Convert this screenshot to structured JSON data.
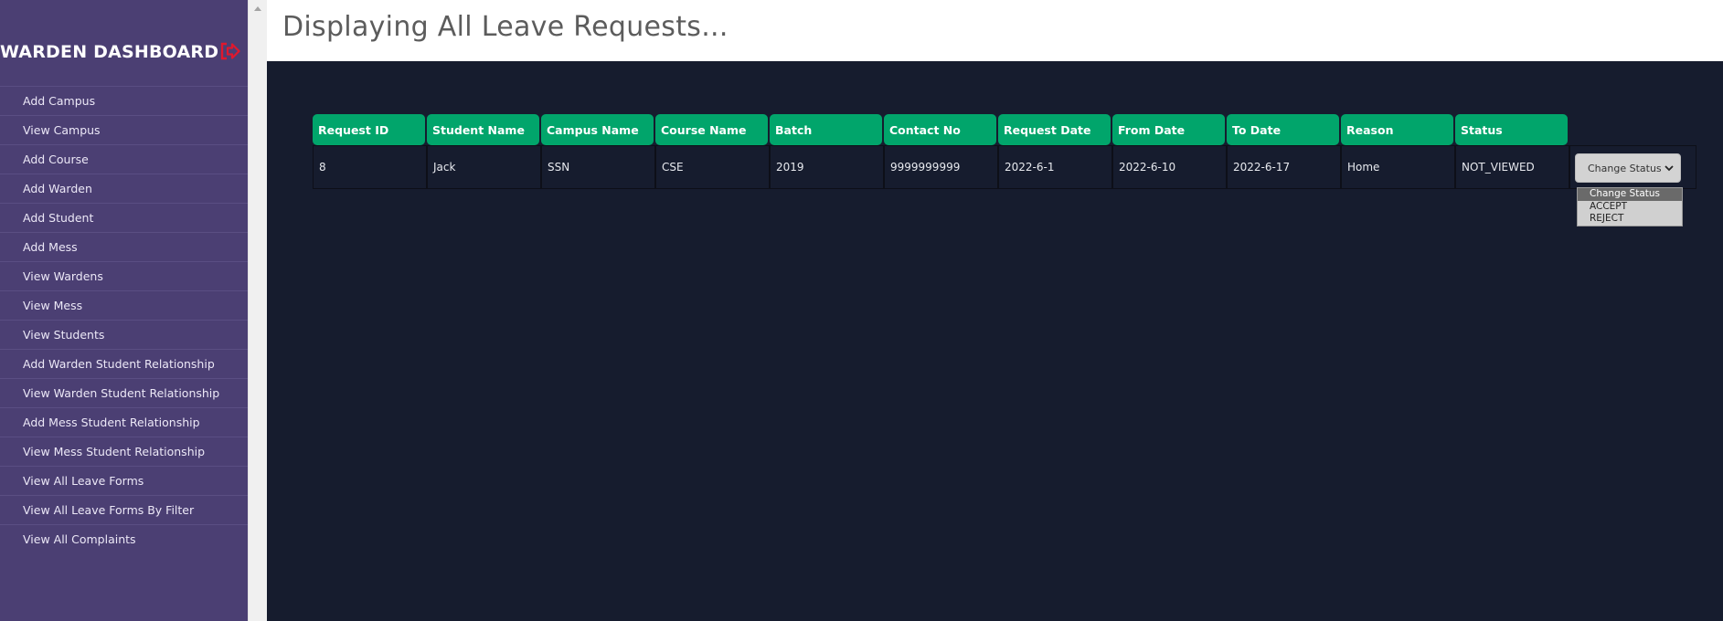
{
  "sidebar": {
    "title": "WARDEN DASHBOARD",
    "items": [
      {
        "label": "Add Campus"
      },
      {
        "label": "View Campus"
      },
      {
        "label": "Add Course"
      },
      {
        "label": "Add Warden"
      },
      {
        "label": "Add Student"
      },
      {
        "label": "Add Mess"
      },
      {
        "label": "View Wardens"
      },
      {
        "label": "View Mess"
      },
      {
        "label": "View Students"
      },
      {
        "label": "Add Warden Student Relationship"
      },
      {
        "label": "View Warden Student Relationship"
      },
      {
        "label": "Add Mess Student Relationship"
      },
      {
        "label": "View Mess Student Relationship"
      },
      {
        "label": "View All Leave Forms"
      },
      {
        "label": "View All Leave Forms By Filter"
      },
      {
        "label": "View All Complaints"
      }
    ]
  },
  "header": {
    "title": "Displaying All Leave Requests..."
  },
  "table": {
    "columns": [
      "Request ID",
      "Student Name",
      "Campus Name",
      "Course Name",
      "Batch",
      "Contact No",
      "Request Date",
      "From Date",
      "To Date",
      "Reason",
      "Status"
    ],
    "rows": [
      [
        "8",
        "Jack",
        "SSN",
        "CSE",
        "2019",
        "9999999999",
        "2022-6-1",
        "2022-6-10",
        "2022-6-17",
        "Home",
        "NOT_VIEWED"
      ]
    ]
  },
  "status_select": {
    "value": "Change Status",
    "options": [
      "Change Status",
      "ACCEPT",
      "REJECT"
    ],
    "selected_index": 0
  },
  "colors": {
    "sidebar_bg": "#4b3f73",
    "main_bg": "#161c2e",
    "header_cell": "#01a56b",
    "logout_icon": "#e0182d"
  },
  "icons": {
    "logout": "logout-icon",
    "chevron": "chevron-down-icon"
  }
}
